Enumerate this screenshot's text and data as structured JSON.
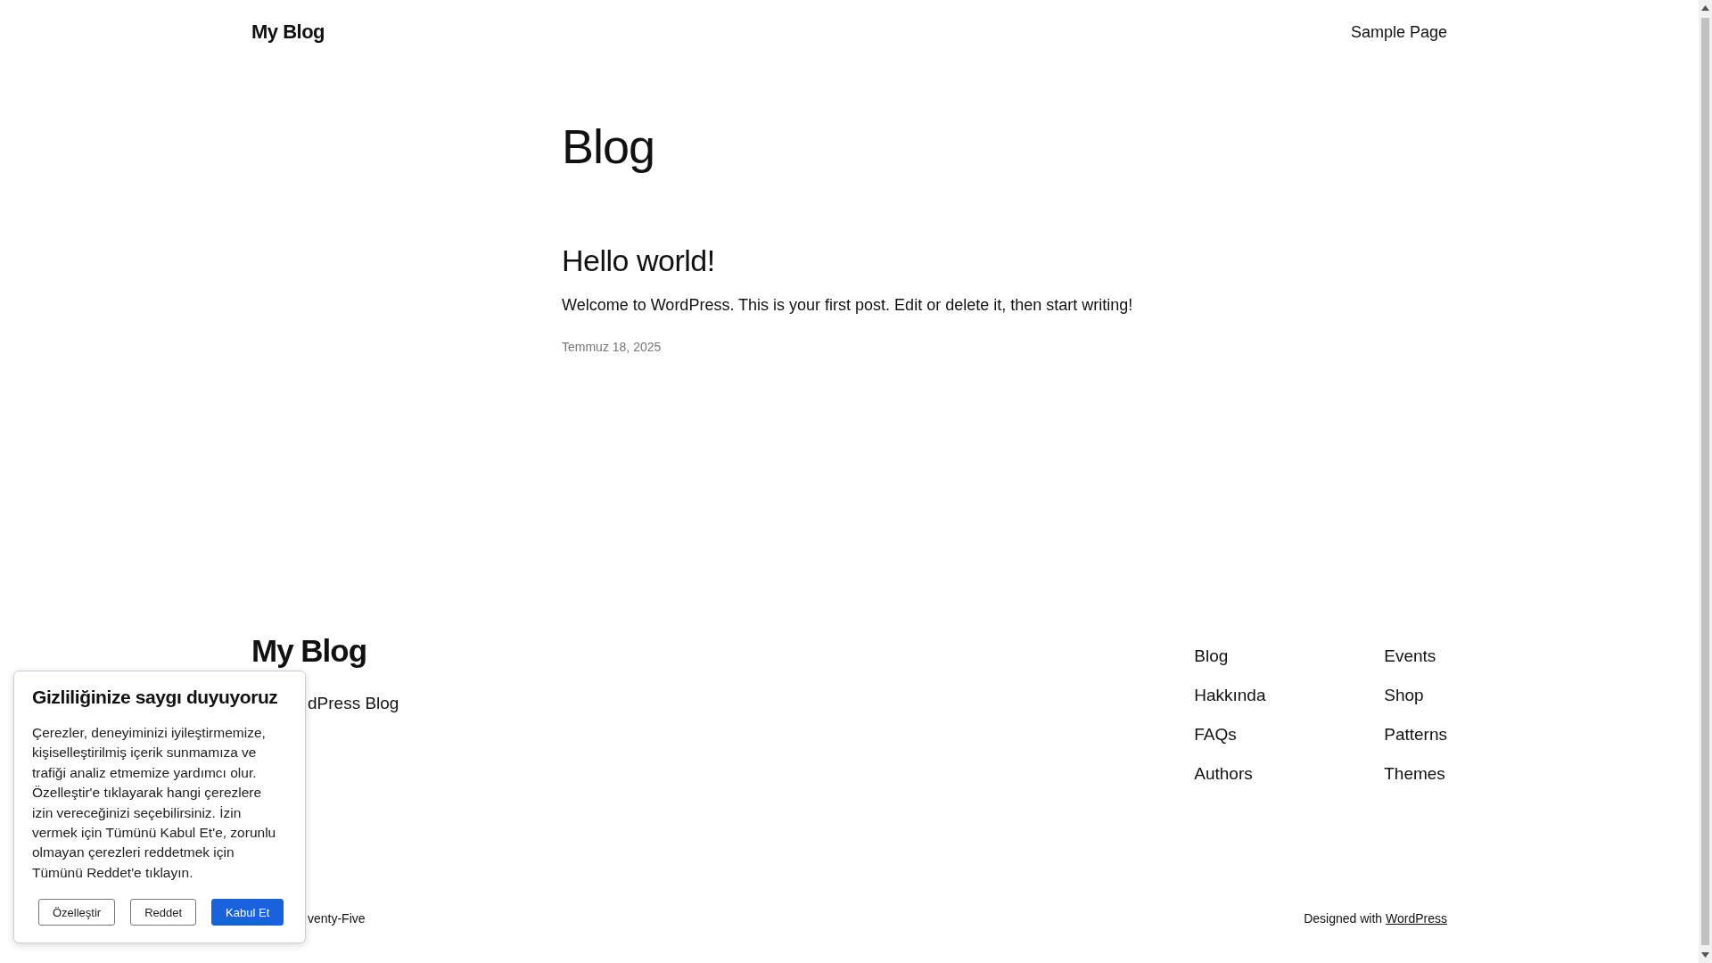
{
  "header": {
    "site_title": "My Blog",
    "nav": [
      "Sample Page"
    ]
  },
  "main": {
    "title": "Blog",
    "posts": [
      {
        "title": "Hello world!",
        "excerpt": "Welcome to WordPress. This is your first post. Edit or delete it, then start writing!",
        "date": "Temmuz 18, 2025"
      }
    ]
  },
  "footer": {
    "site_title": "My Blog",
    "tagline": "dPress Blog",
    "nav_columns": [
      [
        "Blog",
        "Hakkında",
        "FAQs",
        "Authors"
      ],
      [
        "Events",
        "Shop",
        "Patterns",
        "Themes"
      ]
    ],
    "credit_left": "venty-Five",
    "credit_prefix": "Designed with",
    "credit_link": "WordPress"
  },
  "cookie_banner": {
    "title": "Gizliliğinize saygı duyuyoruz",
    "text": "Çerezler, deneyiminizi iyileştirmemize, kişiselleştirilmiş içerik sunmamıza ve trafiği analiz etmemize yardımcı olur. Özelleştir'e tıklayarak hangi çerezlere izin vereceğinizi seçebilirsiniz. İzin vermek için Tümünü Kabul Et'e, zorunlu olmayan çerezleri reddetmek için Tümünü Reddet'e tıklayın.",
    "buttons": [
      {
        "label": "Özelleştir",
        "kind": "outline"
      },
      {
        "label": "Reddet",
        "kind": "outline"
      },
      {
        "label": "Kabul Et",
        "kind": "primary"
      }
    ]
  }
}
